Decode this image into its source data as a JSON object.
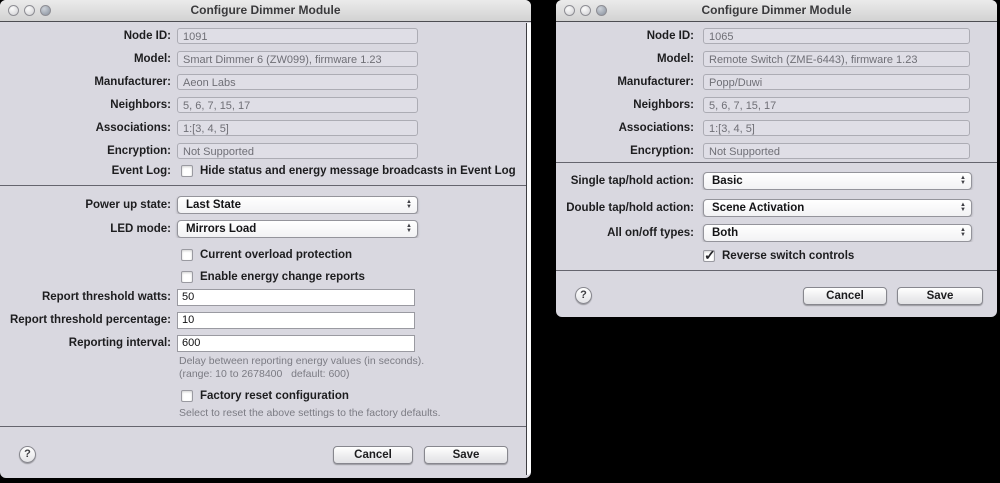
{
  "colors": {
    "window_bg": "#d9d8e0",
    "titlebar_top": "#ebebeb",
    "titlebar_bottom": "#d2d2d2",
    "readonly_value_text": "#6f6f76",
    "help_text": "#7b7b83"
  },
  "left_window": {
    "title": "Configure Dimmer Module",
    "info_fields": [
      {
        "label": "Node ID:",
        "value": "1091"
      },
      {
        "label": "Model:",
        "value": "Smart Dimmer 6 (ZW099), firmware 1.23"
      },
      {
        "label": "Manufacturer:",
        "value": "Aeon Labs"
      },
      {
        "label": "Neighbors:",
        "value": "5, 6, 7, 15, 17"
      },
      {
        "label": "Associations:",
        "value": "1:[3, 4, 5]"
      },
      {
        "label": "Encryption:",
        "value": "Not Supported"
      }
    ],
    "event_log": {
      "label": "Event Log:",
      "checkbox_label": "Hide status and energy message broadcasts in Event Log",
      "checked": false
    },
    "popups": [
      {
        "label": "Power up state:",
        "value": "Last State"
      },
      {
        "label": "LED mode:",
        "value": "Mirrors Load"
      }
    ],
    "option_checkboxes": [
      {
        "label": "Current overload protection",
        "checked": false
      },
      {
        "label": "Enable energy change reports",
        "checked": false
      }
    ],
    "text_fields": [
      {
        "label": "Report threshold watts:",
        "value": "50"
      },
      {
        "label": "Report threshold percentage:",
        "value": "10"
      },
      {
        "label": "Reporting interval:",
        "value": "600"
      }
    ],
    "interval_help_line1": "Delay between reporting energy values (in seconds).",
    "interval_help_line2": "(range: 10 to 2678400   default: 600)",
    "factory_reset": {
      "label": "Factory reset configuration",
      "checked": false
    },
    "factory_reset_help": "Select to reset the above settings to the factory defaults.",
    "help_button_label": "?",
    "cancel_label": "Cancel",
    "save_label": "Save"
  },
  "right_window": {
    "title": "Configure Dimmer Module",
    "info_fields": [
      {
        "label": "Node ID:",
        "value": "1065"
      },
      {
        "label": "Model:",
        "value": "Remote Switch (ZME-6443), firmware 1.23"
      },
      {
        "label": "Manufacturer:",
        "value": "Popp/Duwi"
      },
      {
        "label": "Neighbors:",
        "value": "5, 6, 7, 15, 17"
      },
      {
        "label": "Associations:",
        "value": "1:[3, 4, 5]"
      },
      {
        "label": "Encryption:",
        "value": "Not Supported"
      }
    ],
    "popups": [
      {
        "label": "Single tap/hold action:",
        "value": "Basic"
      },
      {
        "label": "Double tap/hold action:",
        "value": "Scene Activation"
      },
      {
        "label": "All on/off types:",
        "value": "Both"
      }
    ],
    "reverse_checkbox": {
      "label": "Reverse switch controls",
      "checked": true
    },
    "help_button_label": "?",
    "cancel_label": "Cancel",
    "save_label": "Save"
  },
  "icons": {
    "popup_up_arrow": "▲",
    "popup_down_arrow": "▼"
  }
}
